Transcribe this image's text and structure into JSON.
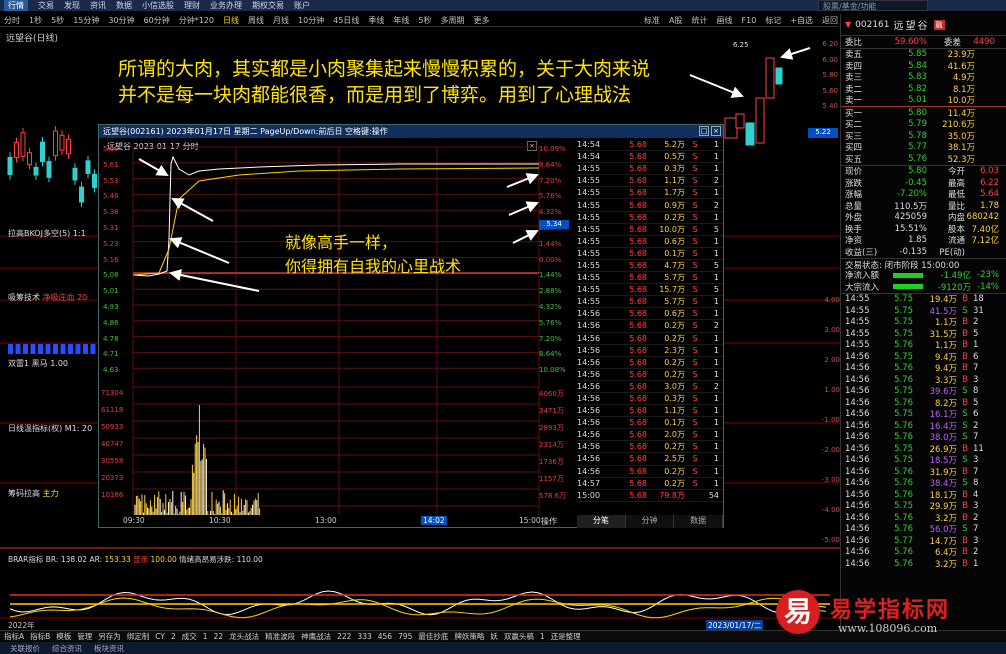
{
  "menubar": {
    "items": [
      "行情",
      "交易",
      "发现",
      "资讯",
      "数据",
      "小信选股",
      "理财",
      "业务办理",
      "期权交易",
      "账户"
    ],
    "search_placeholder": "股票/基金/功能"
  },
  "periodbar": {
    "items": [
      "分时",
      "1秒",
      "5秒",
      "15分钟",
      "30分钟",
      "60分钟",
      "分钟*120",
      "日线",
      "周线",
      "月线",
      "10分钟",
      "45日线",
      "季线",
      "年线",
      "5秒",
      "多周期",
      "更多"
    ],
    "tools": [
      "标准",
      "A股",
      "统计",
      "画线",
      "F10",
      "标记",
      "+自选",
      "返回"
    ]
  },
  "stock_title": "远望谷(日线)",
  "main_chart": {
    "price_ticks_right": [
      "6.20",
      "6.00",
      "5.80",
      "5.60",
      "5.40"
    ],
    "current_label": "5.22",
    "high_label": "6.25",
    "right_ticks_lower": [
      "4.00",
      "3.00",
      "2.00",
      "1.00",
      "-1.00",
      "-2.00",
      "-3.00",
      "-4.00",
      "-5.00"
    ],
    "date_left": "2022年",
    "date_right": "2023/01/17/二",
    "indicators": [
      {
        "name": "拉高BKOJ多空(5) 1:1",
        "value": ""
      },
      {
        "name": "吸筹技术",
        "value": "净吸庄血 20"
      },
      {
        "name": "双雷1 黑马",
        "value": "1.00"
      },
      {
        "name": "日线温指标(权) M1:",
        "value": "20"
      },
      {
        "name": "筹码拉高",
        "value": "主力"
      }
    ],
    "brar": {
      "label": "BRAR指标 BR:",
      "br": "138.02",
      "ar_label": "AR:",
      "ar": "153.33",
      "extra": "显示",
      "extra_val": "100.00",
      "tip": "情绪高昂易涉跌: 110.00"
    }
  },
  "captions": {
    "line1": "所谓的大肉，其实都是小肉聚集起来慢慢积累的，关于大肉来说",
    "line2": "并不是每一块肉都能很香，而是用到了博弈。用到了心理战法",
    "inner1": "就像高手一样，",
    "inner2": "你得拥有自我的心里战术"
  },
  "popup": {
    "title": "远望谷(002161) 2023年01月17日 星期二 PageUp/Down:前后日 空格键:操作",
    "subtitle": "远望谷 2023-01-17 分时",
    "price_ticks": [
      "5.68",
      "5.61",
      "5.53",
      "5.46",
      "5.38",
      "5.31",
      "5.23",
      "5.16",
      "5.08",
      "5.01",
      "4.93",
      "4.86",
      "4.78",
      "4.71",
      "4.63"
    ],
    "pct_ticks": [
      "10.09%",
      "8.64%",
      "7.20%",
      "5.76%",
      "4.32%",
      "2.88%",
      "1.44%",
      "0.00%",
      "1.44%",
      "2.88%",
      "4.32%",
      "5.76%",
      "7.20%",
      "8.64%",
      "10.08%"
    ],
    "vol_ticks_left": [
      "71304",
      "61118",
      "50933",
      "40747",
      "30558",
      "20373",
      "10186"
    ],
    "vol_ticks_right": [
      "4060万",
      "3471万",
      "2893万",
      "2314万",
      "1736万",
      "1157万",
      "578.6万"
    ],
    "time_ticks": [
      "09:30",
      "10:30",
      "13:00",
      "14:02",
      "15:00"
    ],
    "cursor_price": "5.34",
    "footer_btn": "操作",
    "tabs": [
      "分笔",
      "分钟",
      "数据"
    ],
    "ticks": [
      [
        "14:54",
        "5.68",
        "5.2万",
        "S",
        "1"
      ],
      [
        "14:54",
        "5.68",
        "0.5万",
        "S",
        "1"
      ],
      [
        "14:55",
        "5.68",
        "0.3万",
        "S",
        "1"
      ],
      [
        "14:55",
        "5.68",
        "1.1万",
        "S",
        "2"
      ],
      [
        "14:55",
        "5.68",
        "1.7万",
        "S",
        "1"
      ],
      [
        "14:55",
        "5.68",
        "0.9万",
        "S",
        "2"
      ],
      [
        "14:55",
        "5.68",
        "0.2万",
        "S",
        "1"
      ],
      [
        "14:55",
        "5.68",
        "10.0万",
        "S",
        "5"
      ],
      [
        "14:55",
        "5.68",
        "0.6万",
        "S",
        "1"
      ],
      [
        "14:55",
        "5.68",
        "0.1万",
        "S",
        "1"
      ],
      [
        "14:55",
        "5.68",
        "4.7万",
        "S",
        "5"
      ],
      [
        "14:55",
        "5.68",
        "5.7万",
        "S",
        "1"
      ],
      [
        "14:55",
        "5.68",
        "15.7万",
        "S",
        "5"
      ],
      [
        "14:55",
        "5.68",
        "5.7万",
        "S",
        "1"
      ],
      [
        "14:56",
        "5.68",
        "0.6万",
        "S",
        "1"
      ],
      [
        "14:56",
        "5.68",
        "0.2万",
        "S",
        "2"
      ],
      [
        "14:56",
        "5.68",
        "0.2万",
        "S",
        "1"
      ],
      [
        "14:56",
        "5.68",
        "2.3万",
        "S",
        "1"
      ],
      [
        "14:56",
        "5.68",
        "0.2万",
        "S",
        "1"
      ],
      [
        "14:56",
        "5.68",
        "0.2万",
        "S",
        "1"
      ],
      [
        "14:56",
        "5.68",
        "3.0万",
        "S",
        "2"
      ],
      [
        "14:56",
        "5.68",
        "0.3万",
        "S",
        "1"
      ],
      [
        "14:56",
        "5.68",
        "1.1万",
        "S",
        "1"
      ],
      [
        "14:56",
        "5.68",
        "0.1万",
        "S",
        "1"
      ],
      [
        "14:56",
        "5.68",
        "2.0万",
        "S",
        "1"
      ],
      [
        "14:56",
        "5.68",
        "0.2万",
        "S",
        "1"
      ],
      [
        "14:56",
        "5.68",
        "2.5万",
        "S",
        "1"
      ],
      [
        "14:56",
        "5.68",
        "0.2万",
        "S",
        "1"
      ],
      [
        "14:57",
        "5.68",
        "0.2万",
        "S",
        "1"
      ],
      [
        "15:00",
        "5.68",
        "79.8万",
        "",
        "54"
      ]
    ]
  },
  "right_panel": {
    "code": "002161",
    "name": "远望谷",
    "badge": "融",
    "weibi_label": "委比",
    "weibi": "59.60%",
    "weicha_label": "委差",
    "weicha": "4490",
    "sells": [
      [
        "卖五",
        "5.85",
        "23.9万"
      ],
      [
        "卖四",
        "5.84",
        "41.6万"
      ],
      [
        "卖三",
        "5.83",
        "4.9万"
      ],
      [
        "卖二",
        "5.82",
        "8.1万"
      ],
      [
        "卖一",
        "5.01",
        "10.0万"
      ]
    ],
    "buys": [
      [
        "买一",
        "5.80",
        "11.4万"
      ],
      [
        "买二",
        "5.79",
        "210.6万"
      ],
      [
        "买三",
        "5.78",
        "35.0万"
      ],
      [
        "买四",
        "5.77",
        "38.1万"
      ],
      [
        "买五",
        "5.76",
        "52.3万"
      ]
    ],
    "quotes": [
      [
        "现价",
        "5.80",
        "今开",
        "6.03"
      ],
      [
        "涨跌",
        "-0.45",
        "最高",
        "6.22"
      ],
      [
        "涨幅",
        "-7.20%",
        "最低",
        "5.64"
      ],
      [
        "总量",
        "110.5万",
        "量比",
        "1.78"
      ],
      [
        "外盘",
        "425059",
        "内盘",
        "680242"
      ],
      [
        "换手",
        "15.51%",
        "股本",
        "7.40亿"
      ],
      [
        "净资",
        "1.85",
        "流通",
        "7.12亿"
      ],
      [
        "收益(三)",
        "-0.135",
        "PE(动)",
        ""
      ]
    ],
    "trade_status": "交易状态: 闭市阶段 15:00:00",
    "inflow": [
      [
        "净流入额",
        "-1.49亿",
        "-23%"
      ],
      [
        "大宗流入",
        "-9120万",
        "-14%"
      ]
    ],
    "trades": [
      [
        "14:55",
        "5.75",
        "19.4万",
        "B",
        "18"
      ],
      [
        "14:55",
        "5.75",
        "41.5万",
        "S",
        "31"
      ],
      [
        "14:55",
        "5.75",
        "1.1万",
        "B",
        "2"
      ],
      [
        "14:55",
        "5.75",
        "31.5万",
        "B",
        "5"
      ],
      [
        "14:55",
        "5.76",
        "1.1万",
        "B",
        "1"
      ],
      [
        "14:56",
        "5.75",
        "9.4万",
        "B",
        "6"
      ],
      [
        "14:56",
        "5.76",
        "9.4万",
        "B",
        "7"
      ],
      [
        "14:56",
        "5.76",
        "3.3万",
        "B",
        "3"
      ],
      [
        "14:56",
        "5.75",
        "39.6万",
        "S",
        "8"
      ],
      [
        "14:56",
        "5.76",
        "8.2万",
        "B",
        "5"
      ],
      [
        "14:56",
        "5.75",
        "16.1万",
        "S",
        "6"
      ],
      [
        "14:56",
        "5.76",
        "16.4万",
        "S",
        "2"
      ],
      [
        "14:56",
        "5.76",
        "38.0万",
        "S",
        "7"
      ],
      [
        "14:56",
        "5.75",
        "26.9万",
        "B",
        "11"
      ],
      [
        "14:56",
        "5.75",
        "18.5万",
        "S",
        "3"
      ],
      [
        "14:56",
        "5.76",
        "31.9万",
        "B",
        "7"
      ],
      [
        "14:56",
        "5.76",
        "38.4万",
        "S",
        "8"
      ],
      [
        "14:56",
        "5.76",
        "18.1万",
        "B",
        "4"
      ],
      [
        "14:56",
        "5.75",
        "29.9万",
        "B",
        "3"
      ],
      [
        "14:56",
        "5.76",
        "3.2万",
        "B",
        "2"
      ],
      [
        "14:56",
        "5.76",
        "56.0万",
        "S",
        "7"
      ],
      [
        "14:56",
        "5.77",
        "14.7万",
        "B",
        "3"
      ],
      [
        "14:56",
        "5.76",
        "6.4万",
        "B",
        "2"
      ],
      [
        "14:56",
        "5.76",
        "3.2万",
        "B",
        "1"
      ]
    ]
  },
  "bottombar": [
    "指标A",
    "指标B",
    "模板",
    "管理",
    "另存为",
    "绑定制",
    "CY",
    "2",
    "成交",
    "1",
    "22",
    "龙头战法",
    "精准波段",
    "神鹰战法",
    "222",
    "333",
    "456",
    "795",
    "最佳抄底",
    "牌妖策略",
    "妖",
    "双赢头稿",
    "1",
    "还是整理"
  ],
  "statusbar": [
    "关联报价",
    "综合资讯",
    "板块资讯"
  ],
  "watermark": {
    "title": "易学指标网",
    "url": "www.108096.com",
    "logo_char": "易"
  },
  "colors": {
    "up": "#ff3030",
    "down": "#20d020",
    "caption": "#ffe400",
    "accent": "#2a5a9a"
  }
}
